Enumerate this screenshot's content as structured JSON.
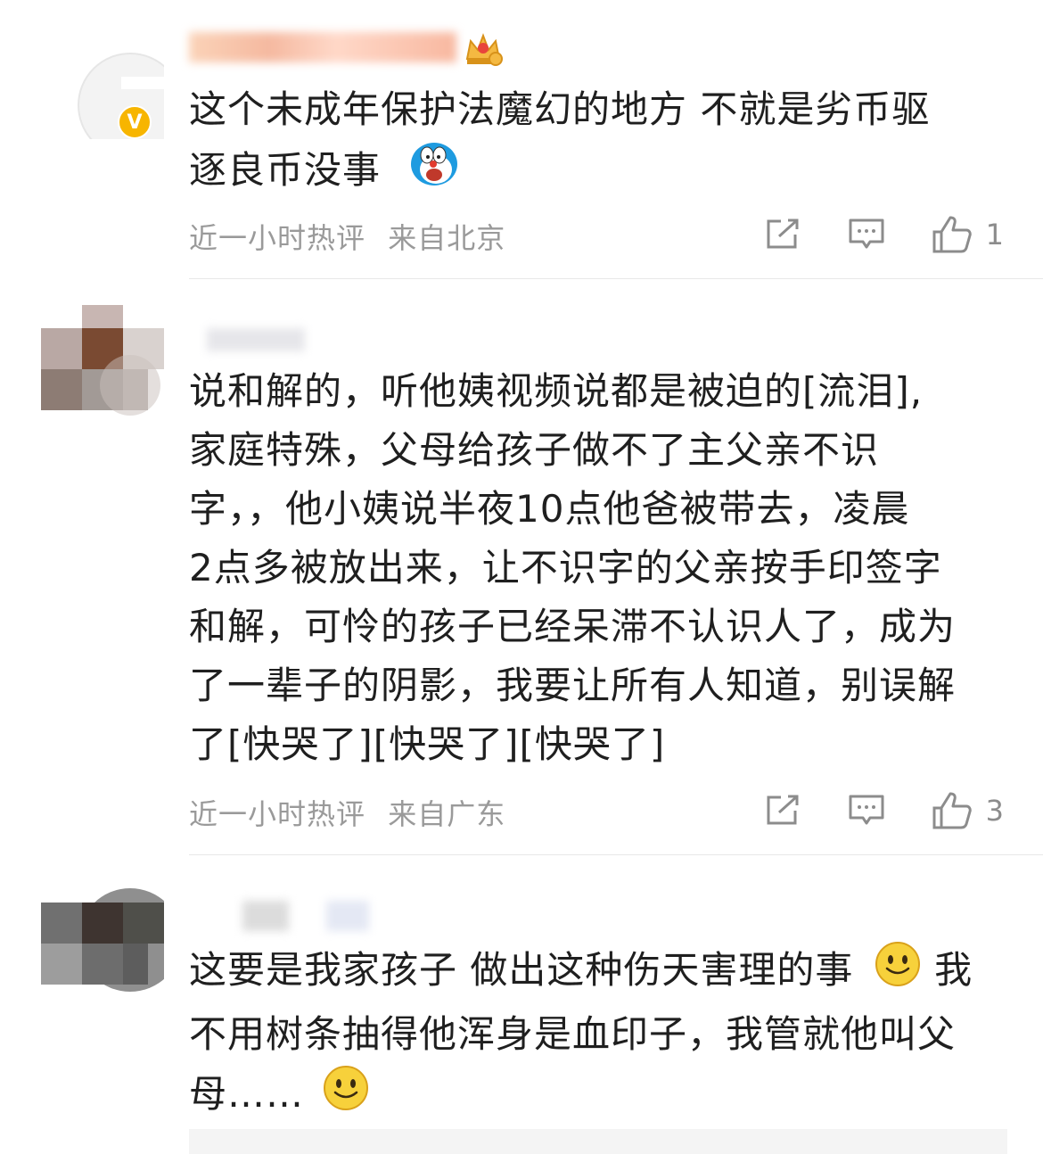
{
  "comments": [
    {
      "text_lines": [
        "这个未成年保护法魔幻的地方 不就是劣币驱",
        "逐良币没事"
      ],
      "time": "近一小时热评",
      "location": "来自北京",
      "likes": "1",
      "verified_badge": "V",
      "icons": [
        "crown-badge-icon",
        "doraemon-emoji-icon"
      ]
    },
    {
      "text_lines": [
        "说和解的，听他姨视频说都是被迫的[流泪],",
        "家庭特殊，父母给孩子做不了主父亲不识",
        "字，，他小姨说半夜10点他爸被带去，凌晨",
        "2点多被放出来，让不识字的父亲按手印签字",
        "和解，可怜的孩子已经呆滞不认识人了，成为",
        "了一辈子的阴影，我要让所有人知道，别误解",
        "了[快哭了][快哭了][快哭了]"
      ],
      "time": "近一小时热评",
      "location": "来自广东",
      "likes": "3"
    },
    {
      "text_lines": [
        "这要是我家孩子 做出这种伤天害理的事",
        "不用树条抽得他浑身是血印子，我管就他叫父",
        "母……"
      ],
      "inline_tail": "我",
      "icons": [
        "smile-emoji-icon"
      ]
    }
  ],
  "colors": {
    "meta": "#9a9a9a",
    "badge": "#f7b500",
    "text": "#1f1f1f"
  }
}
